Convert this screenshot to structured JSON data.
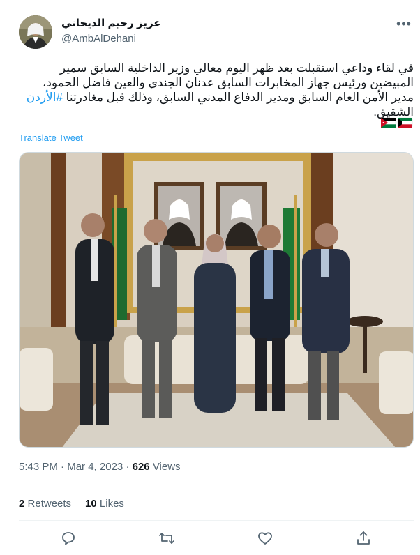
{
  "author": {
    "name": "عزيز رحيم الديحاني",
    "handle": "@AmbAlDehani"
  },
  "tweet": {
    "text_before_hashtag": "في لقاء وداعي استقبلت بعد ظهر اليوم معالي وزير الداخلية السابق سمير المبيضين ورئيس جهاز المخابرات السابق عدنان الجندي والعين فاضل الحمود، مدير الأمن العام السابق ومدير الدفاع المدني السابق، وذلك قبل مغادرتنا ",
    "hashtag": "#الأردن",
    "text_after_hashtag": " الشقيق.",
    "translate_label": "Translate Tweet",
    "flags": [
      "jordan-flag",
      "kuwait-flag"
    ]
  },
  "meta": {
    "time": "5:43 PM",
    "separator": "·",
    "date": "Mar 4, 2023",
    "views_count": "626",
    "views_label": "Views"
  },
  "stats": {
    "retweets_count": "2",
    "retweets_label": "Retweets",
    "likes_count": "10",
    "likes_label": "Likes"
  },
  "actions": [
    "reply-icon",
    "retweet-icon",
    "like-icon",
    "share-icon"
  ],
  "colors": {
    "accent": "#1d9bf0",
    "secondary_text": "#536471",
    "primary_text": "#0f1419",
    "divider": "#eff3f4"
  }
}
